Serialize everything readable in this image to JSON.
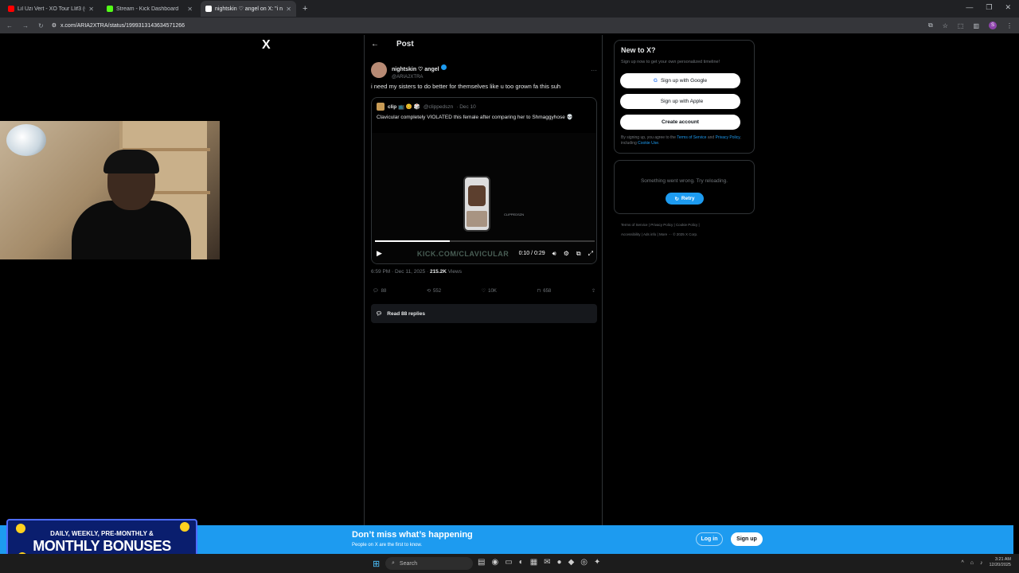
{
  "browser": {
    "tabs": [
      {
        "title": "Lil Uzi Vert - XO Tour Llif3 (Offi",
        "color": "#ff0000",
        "active": false
      },
      {
        "title": "Stream - Kick Dashboard",
        "color": "#53fc18",
        "active": false
      },
      {
        "title": "nightskin ♡ angel on X: \"i need",
        "color": "#ffffff",
        "active": true
      }
    ],
    "new_tab": "+",
    "url": "x.com/ARIA2XTRA/status/1999313143634571266"
  },
  "x_logo": "X",
  "post_header": {
    "back": "←",
    "title": "Post"
  },
  "tweet": {
    "author_name": "nightskin ♡ angel",
    "author_handle": "@ARIA2XTRA",
    "more": "···",
    "text": "i need my sisters to do better for themselves like u too grown fa this suh",
    "quote": {
      "name": "clip 📺 😊 🎲",
      "handle": "@clippedszn",
      "date": "· Dec 10",
      "text": "Clavicular completely VIOLATED this female after comparing her to Shmaggyhose 💀",
      "video_label": "CLIPPEDSZN",
      "progress": 0.34,
      "watermark": "KICK.COM/CLAVICULAR",
      "time": "0:10 / 0:29"
    },
    "timestamp": "6:59 PM · Dec 11, 2025 · ",
    "views_count": "215.2K",
    "views_label": " Views",
    "actions": {
      "replies": "88",
      "reposts": "552",
      "likes": "10K",
      "bookmarks": "658"
    },
    "read_replies": "Read 88 replies"
  },
  "sidebar": {
    "title": "New to X?",
    "subtitle": "Sign up now to get your own personalized timeline!",
    "google": "Sign up with Google",
    "apple": "Sign up with Apple",
    "create": "Create account",
    "terms_prefix": "By signing up, you agree to the ",
    "terms_link": "Terms of Service",
    "terms_and": " and ",
    "privacy_link": "Privacy Policy",
    "terms_including": ", including ",
    "cookie_link": "Cookie Use",
    "error": "Something went wrong. Try reloading.",
    "retry": "Retry",
    "footer": [
      "Terms of Service",
      "|",
      "Privacy Policy",
      "|",
      "Cookie Policy",
      "|",
      "Accessibility",
      "|",
      "Ads info",
      "|",
      "More ···",
      "© 2025 X Corp."
    ]
  },
  "banner": {
    "title": "Don’t miss what’s happening",
    "subtitle": "People on X are the first to know.",
    "login": "Log in",
    "signup": "Sign up"
  },
  "promo": {
    "line1": "DAILY, WEEKLY, PRE-MONTHLY &",
    "line2": "MONTHLY BONUSES"
  },
  "taskbar": {
    "search": "Search",
    "time": "3:21 AM",
    "date": "12/20/2025"
  },
  "colors": {
    "accent": "#1d9bf0",
    "background": "#000000",
    "border": "#2f3336",
    "muted": "#71767b"
  }
}
